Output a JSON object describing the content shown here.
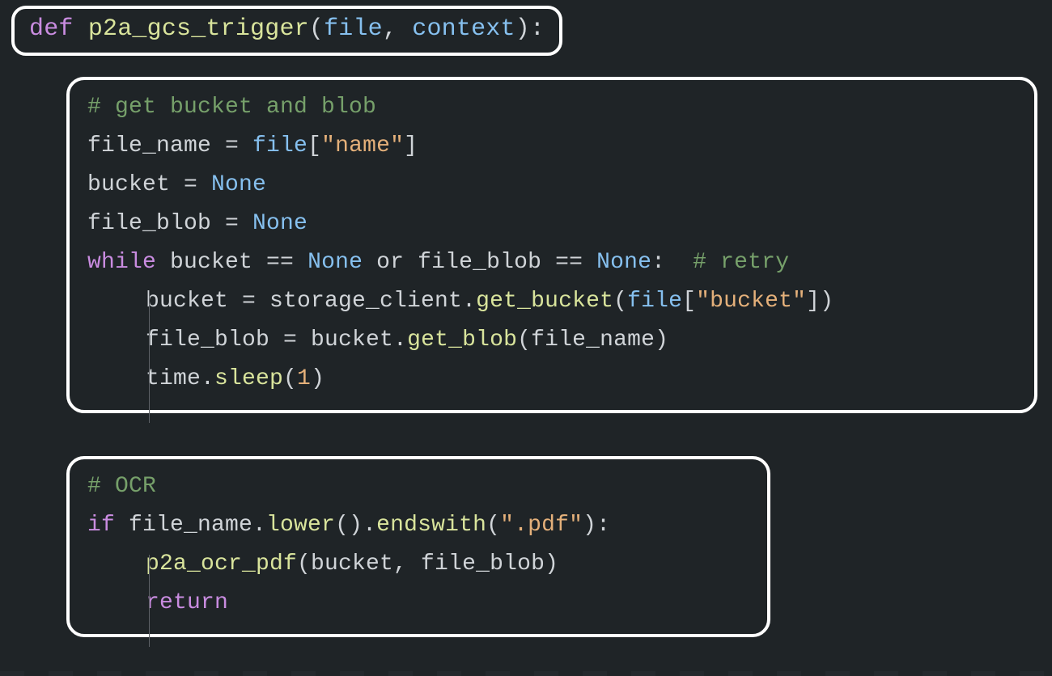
{
  "colors": {
    "bg": "#1f2427",
    "border": "#ffffff",
    "keyword": "#c98ce0",
    "function": "#d9e49c",
    "identifier": "#d0d4d8",
    "param": "#86c0ef",
    "string": "#e4b07a",
    "comment": "#76a06a",
    "number": "#e4b07a"
  },
  "code": {
    "def_line": {
      "kw": "def ",
      "fn": "p2a_gcs_trigger",
      "open": "(",
      "p1": "file",
      "comma": ", ",
      "p2": "context",
      "close": "):"
    },
    "block1": {
      "c1": "# get bucket and blob",
      "l2": {
        "a": "file_name = ",
        "b": "file",
        "c": "[",
        "d": "\"name\"",
        "e": "]"
      },
      "l3": {
        "a": "bucket = ",
        "b": "None"
      },
      "l4": {
        "a": "file_blob = ",
        "b": "None"
      },
      "l5": {
        "kw": "while ",
        "a": "bucket == ",
        "n1": "None",
        "mid": " or file_blob == ",
        "n2": "None",
        "colon": ":",
        "pad": "  ",
        "cmt": "# retry"
      },
      "l6": {
        "a": "bucket = storage_client.",
        "b": "get_bucket",
        "c": "(",
        "d": "file",
        "e": "[",
        "f": "\"bucket\"",
        "g": "])"
      },
      "l7": {
        "a": "file_blob = bucket.",
        "b": "get_blob",
        "c": "(file_name)"
      },
      "l8": {
        "a": "time.",
        "b": "sleep",
        "c": "(",
        "d": "1",
        "e": ")"
      }
    },
    "block2": {
      "c1": "# OCR",
      "l2": {
        "kw": "if ",
        "a": "file_name.",
        "b": "lower",
        "c": "().",
        "d": "endswith",
        "e": "(",
        "f": "\".pdf\"",
        "g": "):"
      },
      "l3": {
        "a": "p2a_ocr_pdf",
        "b": "(bucket, file_blob)"
      },
      "l4": {
        "kw": "return"
      }
    }
  }
}
